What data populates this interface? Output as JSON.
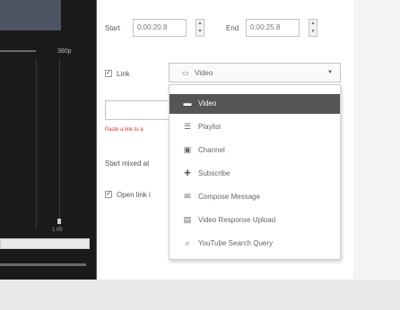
{
  "player": {
    "quality_label": "360p",
    "time_value": "1:05"
  },
  "start": {
    "label": "Start",
    "value": "0:00:20.8"
  },
  "end": {
    "label": "End",
    "value": "0:00:25.8"
  },
  "link": {
    "checkbox_checked": true,
    "label": "Link",
    "type_select": {
      "icon": "video-icon",
      "value": "Video"
    },
    "error_text": "Paste a link to a"
  },
  "start_mixed_label": "Start mixed at",
  "open_link_label": "Open link i",
  "dropdown": {
    "items": [
      {
        "icon": "video-icon",
        "label": "Video",
        "selected": true
      },
      {
        "icon": "playlist-icon",
        "label": "Playlist",
        "selected": false
      },
      {
        "icon": "channel-icon",
        "label": "Channel",
        "selected": false
      },
      {
        "icon": "subscribe-icon",
        "label": "Subscribe",
        "selected": false
      },
      {
        "icon": "compose-message-icon",
        "label": "Compose Message",
        "selected": false
      },
      {
        "icon": "video-response-upload-icon",
        "label": "Video Response Upload",
        "selected": false
      },
      {
        "icon": "search-icon",
        "label": "YouTube Search Query",
        "selected": false
      }
    ]
  }
}
